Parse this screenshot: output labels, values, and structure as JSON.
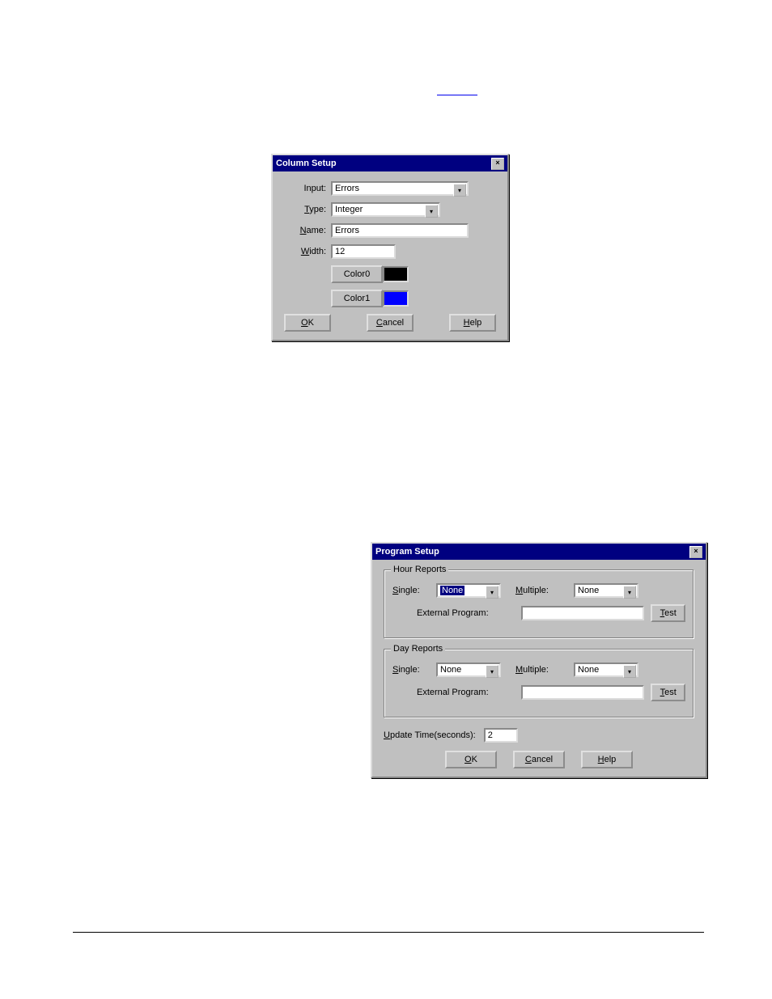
{
  "toplink": " ",
  "dialog1": {
    "title": "Column Setup",
    "labels": {
      "input": "Input:",
      "type": "Type:",
      "name": "Name:",
      "width": "Width:"
    },
    "values": {
      "input": "Errors",
      "type": "Integer",
      "name": "Errors",
      "width": "12"
    },
    "color0_label": "Color0",
    "color1_label": "Color1",
    "color0": "#000000",
    "color1": "#0000ff",
    "buttons": {
      "ok": "OK",
      "cancel": "Cancel",
      "help": "Help"
    }
  },
  "dialog2": {
    "title": "Program Setup",
    "groups": {
      "hour": "Hour Reports",
      "day": "Day Reports"
    },
    "labels": {
      "single": "Single:",
      "multiple": "Multiple:",
      "external": "External Program:",
      "update": "Update Time(seconds):"
    },
    "values": {
      "hour_single": "None",
      "hour_multiple": "None",
      "hour_external": "",
      "day_single": "None",
      "day_multiple": "None",
      "day_external": "",
      "update_time": "2"
    },
    "buttons": {
      "test": "Test",
      "ok": "OK",
      "cancel": "Cancel",
      "help": "Help"
    }
  }
}
